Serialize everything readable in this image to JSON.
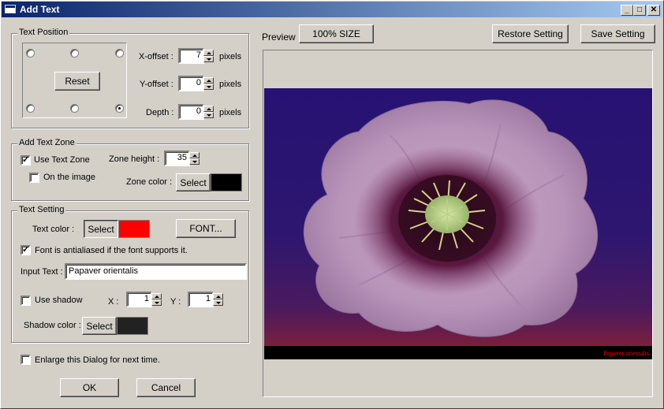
{
  "window": {
    "title": "Add Text",
    "minimize": "_",
    "maximize": "□",
    "close": "✕"
  },
  "text_position": {
    "legend": "Text Position",
    "reset_label": "Reset",
    "selected_anchor": "bottom-right",
    "x_offset": {
      "label": "X-offset :",
      "value": "7",
      "unit": "pixels"
    },
    "y_offset": {
      "label": "Y-offset :",
      "value": "0",
      "unit": "pixels"
    },
    "depth": {
      "label": "Depth :",
      "value": "0",
      "unit": "pixels"
    }
  },
  "text_zone": {
    "legend": "Add Text Zone",
    "use_text_zone": {
      "label": "Use Text Zone",
      "checked": true
    },
    "on_image": {
      "label": "On the image",
      "checked": false
    },
    "zone_height": {
      "label": "Zone height :",
      "value": "35"
    },
    "zone_color": {
      "label": "Zone color :",
      "button": "Select",
      "color": "#000000"
    }
  },
  "text_setting": {
    "legend": "Text Setting",
    "text_color": {
      "label": "Text color :",
      "button": "Select",
      "color": "#ff0000"
    },
    "font_button": "FONT...",
    "antialias": {
      "label": "Font is antialiased if the font supports it.",
      "checked": true
    },
    "input_text": {
      "label": "Input Text :",
      "value": "Papaver orientalis"
    },
    "shadow": {
      "label": "Use shadow",
      "checked": false
    },
    "shadow_x": {
      "label": "X :",
      "value": "1"
    },
    "shadow_y": {
      "label": "Y :",
      "value": "1"
    },
    "shadow_color": {
      "label": "Shadow color :",
      "button": "Select",
      "color": "#222222"
    }
  },
  "enlarge": {
    "label": "Enlarge this Dialog for next time.",
    "checked": false
  },
  "ok_label": "OK",
  "cancel_label": "Cancel",
  "preview": {
    "label": "Preview",
    "size_button": "100% SIZE",
    "restore_button": "Restore Setting",
    "save_button": "Save Setting",
    "caption": "Papaver orientalis",
    "caption_color": "#ff0000",
    "zone_color": "#000000"
  }
}
